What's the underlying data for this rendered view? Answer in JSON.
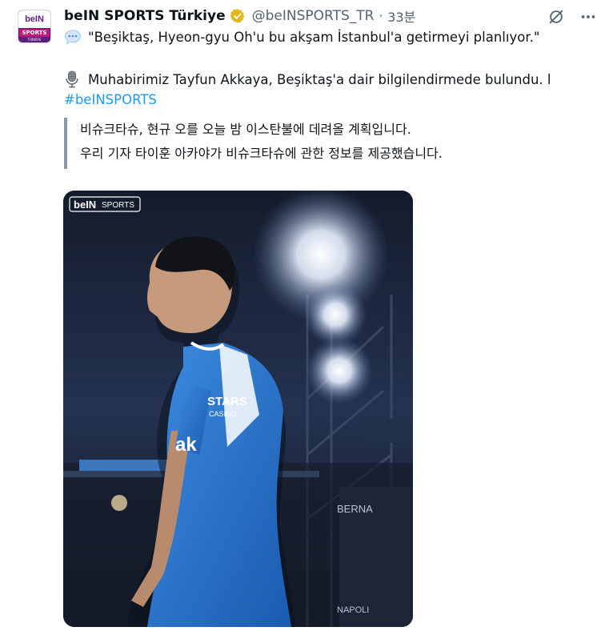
{
  "account": {
    "avatar_logo_text": "beIN",
    "avatar_sub_text": "SPORTS",
    "avatar_country_text": "TÜRKİYE",
    "display_name": "beIN SPORTS Türkiye",
    "handle": "@beINSPORTS_TR",
    "separator": "·",
    "time": "33분",
    "verified": true
  },
  "tweet": {
    "line1": "\"Beşiktaş, Hyeon-gyu Oh'u bu akşam İstanbul'a getirmeyi planlıyor.\"",
    "line2": "Muhabirimiz Tayfun Akkaya, Beşiktaş'a dair bilgilendirmede bulundu. l",
    "hashtag": "#beINSPORTS",
    "line1_icon": "speech-bubble-icon",
    "line2_icon": "microphone-icon"
  },
  "translation": {
    "line1": "비슈크타슈, 현규 오를 오늘 밤 이스탄불에 데려올 계획입니다.",
    "line2": "우리 기자 타이훈 아카야가 비슈크타슈에 관한 정보를 제공했습니다."
  },
  "media": {
    "watermark_logo": "beIN",
    "watermark_text": "SPORTS",
    "jersey_text": "ak",
    "sponsor_text_1": "STARS",
    "sponsor_text_2": "CASINO",
    "stand_text_1": "BERNA",
    "stand_text_2": "NAPOLI"
  },
  "colors": {
    "brand_purple": "#5a1f7a",
    "brand_pink": "#c21879",
    "link_blue": "#1d9bf0",
    "muted_text": "#536471",
    "verified_gold": "#e2b719"
  }
}
